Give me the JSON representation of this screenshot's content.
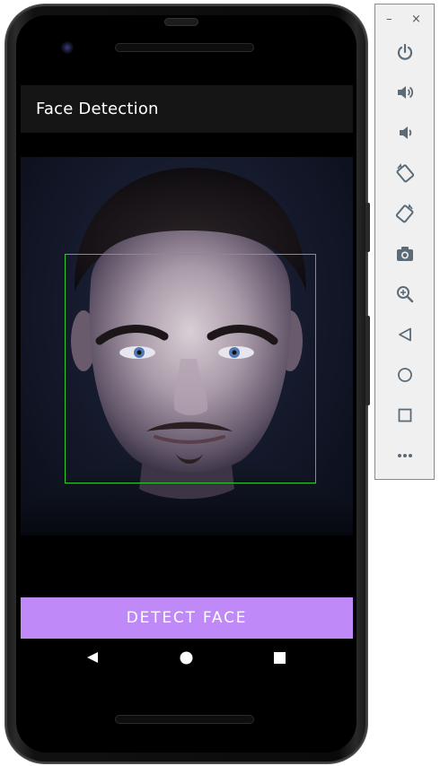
{
  "app": {
    "title": "Face Detection",
    "accent_color": "#bf8af8",
    "app_bar_color": "#151515"
  },
  "photo": {
    "content": "portrait photo of a man's face",
    "detection_box_color": "#2ecc2e"
  },
  "actions": {
    "detect_face_label": "DETECT FACE"
  },
  "nav_bar": {
    "buttons": [
      "back-icon",
      "home-icon",
      "overview-icon"
    ]
  },
  "emulator_toolbar": {
    "window_controls": [
      "minimize-icon",
      "close-icon"
    ],
    "buttons": [
      "power-icon",
      "volume-up-icon",
      "volume-down-icon",
      "rotate-left-icon",
      "rotate-right-icon",
      "camera-icon",
      "zoom-icon",
      "back-icon",
      "home-icon",
      "overview-icon",
      "more-icon"
    ]
  }
}
